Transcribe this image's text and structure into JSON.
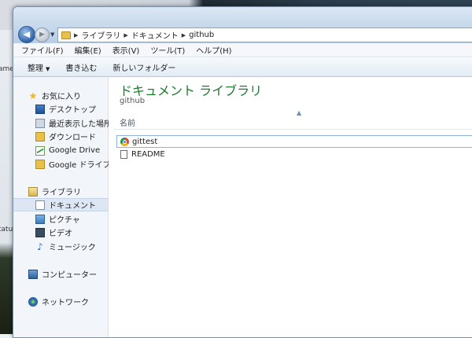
{
  "background": {
    "left_fragments": [
      "ame",
      "tatus"
    ]
  },
  "address_bar": {
    "breadcrumbs": [
      "ライブラリ",
      "ドキュメント",
      "github"
    ]
  },
  "menu": [
    "ファイル(F)",
    "編集(E)",
    "表示(V)",
    "ツール(T)",
    "ヘルプ(H)"
  ],
  "toolbar": {
    "organize": "整理",
    "burn": "書き込む",
    "new_folder": "新しいフォルダー"
  },
  "sidebar": {
    "favorites": {
      "label": "お気に入り",
      "items": [
        "デスクトップ",
        "最近表示した場所",
        "ダウンロード",
        "Google Drive",
        "Google ドライブ"
      ]
    },
    "libraries": {
      "label": "ライブラリ",
      "items": [
        "ドキュメント",
        "ピクチャ",
        "ビデオ",
        "ミュージック"
      ],
      "selected": "ドキュメント"
    },
    "computer": "コンピューター",
    "network": "ネットワーク"
  },
  "content": {
    "library_title": "ドキュメント ライブラリ",
    "subtitle": "github",
    "column_name": "名前",
    "files": [
      {
        "name": "gittest",
        "icon": "chrome-icon",
        "selected": true
      },
      {
        "name": "README",
        "icon": "file-icon",
        "selected": false
      }
    ]
  }
}
